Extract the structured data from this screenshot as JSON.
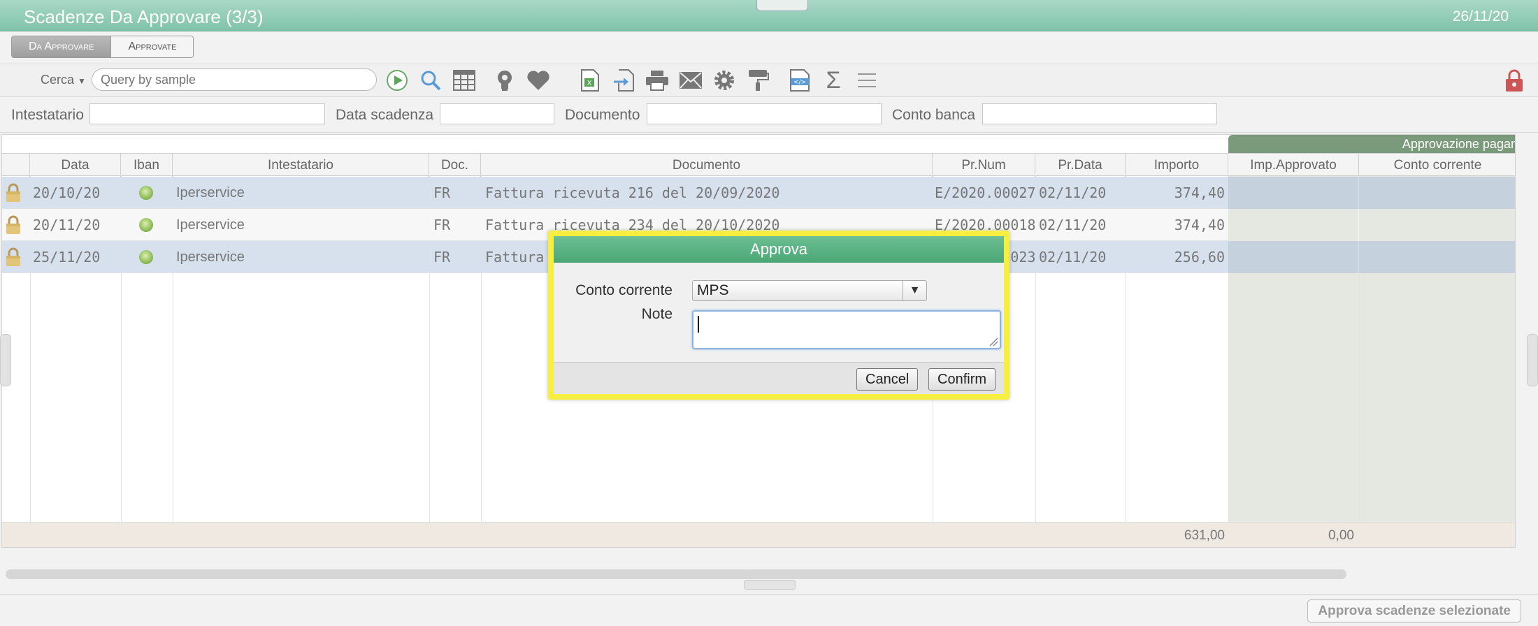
{
  "window": {
    "title": "Scadenze Da Approvare (3/3)",
    "date": "26/11/20"
  },
  "tabs": [
    {
      "label": "Da Approvare",
      "active": true
    },
    {
      "label": "Approvate",
      "active": false
    }
  ],
  "toolbar": {
    "search_label": "Cerca",
    "search_placeholder": "Query by sample",
    "icons": [
      "play-icon",
      "search-icon",
      "table-icon",
      "lightbulb-icon",
      "heart-icon",
      "excel-icon",
      "import-icon",
      "print-icon",
      "mail-icon",
      "gear-icon",
      "paint-roller-icon",
      "code-file-icon",
      "sigma-icon",
      "menu-icon",
      "lock-icon"
    ]
  },
  "filters": {
    "intestatario": "Intestatario",
    "data_scadenza": "Data scadenza",
    "documento": "Documento",
    "conto_banca": "Conto banca"
  },
  "grid": {
    "group_header": "Approvazione pagamento",
    "columns": [
      "Data",
      "Iban",
      "Intestatario",
      "Doc.",
      "Documento",
      "Pr.Num",
      "Pr.Data",
      "Importo",
      "Imp.Approvato",
      "Conto corrente"
    ],
    "rows": [
      {
        "data": "20/10/20",
        "intestatario": "Iperservice",
        "doc": "FR",
        "documento": "Fattura ricevuta 216 del 20/09/2020",
        "prnum": "E/2020.00027",
        "prdata": "02/11/20",
        "importo": "374,40",
        "selected": true
      },
      {
        "data": "20/11/20",
        "intestatario": "Iperservice",
        "doc": "FR",
        "documento": "Fattura ricevuta 234 del 20/10/2020",
        "prnum": "E/2020.00018",
        "prdata": "02/11/20",
        "importo": "374,40",
        "selected": false
      },
      {
        "data": "25/11/20",
        "intestatario": "Iperservice",
        "doc": "FR",
        "documento": "Fattura ricevuta",
        "prnum": "E/2020.00023",
        "prdata": "02/11/20",
        "importo": "256,60",
        "selected": true
      }
    ],
    "totals": {
      "importo": "631,00",
      "imp_approvato": "0,00"
    }
  },
  "footer": {
    "approve_button": "Approva scadenze selezionate"
  },
  "dialog": {
    "title": "Approva",
    "conto_label": "Conto corrente",
    "conto_value": "MPS",
    "note_label": "Note",
    "cancel": "Cancel",
    "confirm": "Confirm"
  }
}
